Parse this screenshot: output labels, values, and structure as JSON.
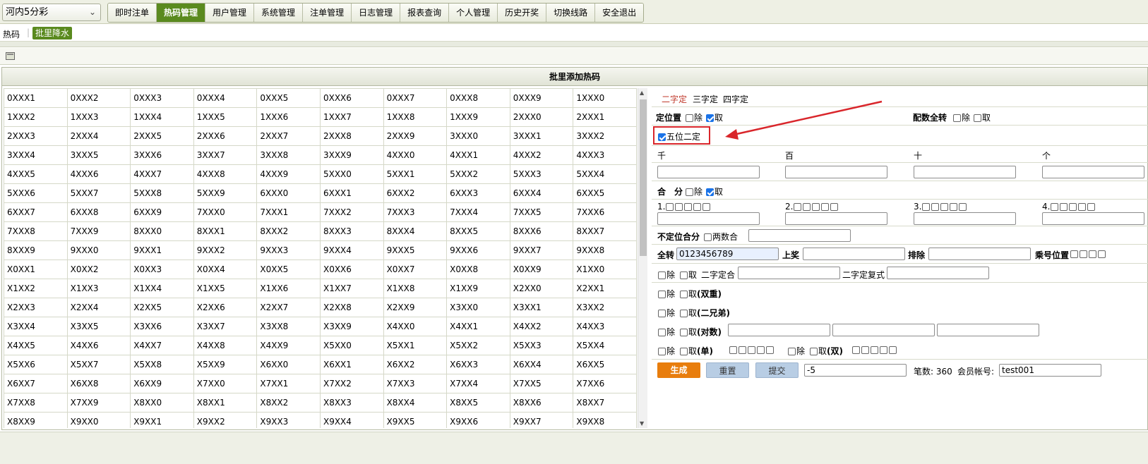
{
  "lottery_select": {
    "value": "河内5分彩"
  },
  "nav": {
    "tabs": [
      "即时注单",
      "热码管理",
      "用户管理",
      "系统管理",
      "注单管理",
      "日志管理",
      "报表查询",
      "个人管理",
      "历史开奖",
      "切换线路",
      "安全退出"
    ],
    "active_index": 1
  },
  "subbar": {
    "label": "热码",
    "action": "批里降水"
  },
  "panel": {
    "title": "批里添加热码"
  },
  "grid": {
    "rows": [
      [
        "0XXX1",
        "0XXX2",
        "0XXX3",
        "0XXX4",
        "0XXX5",
        "0XXX6",
        "0XXX7",
        "0XXX8",
        "0XXX9",
        "1XXX0"
      ],
      [
        "1XXX2",
        "1XXX3",
        "1XXX4",
        "1XXX5",
        "1XXX6",
        "1XXX7",
        "1XXX8",
        "1XXX9",
        "2XXX0",
        "2XXX1"
      ],
      [
        "2XXX3",
        "2XXX4",
        "2XXX5",
        "2XXX6",
        "2XXX7",
        "2XXX8",
        "2XXX9",
        "3XXX0",
        "3XXX1",
        "3XXX2"
      ],
      [
        "3XXX4",
        "3XXX5",
        "3XXX6",
        "3XXX7",
        "3XXX8",
        "3XXX9",
        "4XXX0",
        "4XXX1",
        "4XXX2",
        "4XXX3"
      ],
      [
        "4XXX5",
        "4XXX6",
        "4XXX7",
        "4XXX8",
        "4XXX9",
        "5XXX0",
        "5XXX1",
        "5XXX2",
        "5XXX3",
        "5XXX4"
      ],
      [
        "5XXX6",
        "5XXX7",
        "5XXX8",
        "5XXX9",
        "6XXX0",
        "6XXX1",
        "6XXX2",
        "6XXX3",
        "6XXX4",
        "6XXX5"
      ],
      [
        "6XXX7",
        "6XXX8",
        "6XXX9",
        "7XXX0",
        "7XXX1",
        "7XXX2",
        "7XXX3",
        "7XXX4",
        "7XXX5",
        "7XXX6"
      ],
      [
        "7XXX8",
        "7XXX9",
        "8XXX0",
        "8XXX1",
        "8XXX2",
        "8XXX3",
        "8XXX4",
        "8XXX5",
        "8XXX6",
        "8XXX7"
      ],
      [
        "8XXX9",
        "9XXX0",
        "9XXX1",
        "9XXX2",
        "9XXX3",
        "9XXX4",
        "9XXX5",
        "9XXX6",
        "9XXX7",
        "9XXX8"
      ],
      [
        "X0XX1",
        "X0XX2",
        "X0XX3",
        "X0XX4",
        "X0XX5",
        "X0XX6",
        "X0XX7",
        "X0XX8",
        "X0XX9",
        "X1XX0"
      ],
      [
        "X1XX2",
        "X1XX3",
        "X1XX4",
        "X1XX5",
        "X1XX6",
        "X1XX7",
        "X1XX8",
        "X1XX9",
        "X2XX0",
        "X2XX1"
      ],
      [
        "X2XX3",
        "X2XX4",
        "X2XX5",
        "X2XX6",
        "X2XX7",
        "X2XX8",
        "X2XX9",
        "X3XX0",
        "X3XX1",
        "X3XX2"
      ],
      [
        "X3XX4",
        "X3XX5",
        "X3XX6",
        "X3XX7",
        "X3XX8",
        "X3XX9",
        "X4XX0",
        "X4XX1",
        "X4XX2",
        "X4XX3"
      ],
      [
        "X4XX5",
        "X4XX6",
        "X4XX7",
        "X4XX8",
        "X4XX9",
        "X5XX0",
        "X5XX1",
        "X5XX2",
        "X5XX3",
        "X5XX4"
      ],
      [
        "X5XX6",
        "X5XX7",
        "X5XX8",
        "X5XX9",
        "X6XX0",
        "X6XX1",
        "X6XX2",
        "X6XX3",
        "X6XX4",
        "X6XX5"
      ],
      [
        "X6XX7",
        "X6XX8",
        "X6XX9",
        "X7XX0",
        "X7XX1",
        "X7XX2",
        "X7XX3",
        "X7XX4",
        "X7XX5",
        "X7XX6"
      ],
      [
        "X7XX8",
        "X7XX9",
        "X8XX0",
        "X8XX1",
        "X8XX2",
        "X8XX3",
        "X8XX4",
        "X8XX5",
        "X8XX6",
        "X8XX7"
      ],
      [
        "X8XX9",
        "X9XX0",
        "X9XX1",
        "X9XX2",
        "X9XX3",
        "X9XX4",
        "X9XX5",
        "X9XX6",
        "X9XX7",
        "X9XX8"
      ]
    ]
  },
  "modes": {
    "tabs": [
      "二字定",
      "三字定",
      "四字定"
    ],
    "active_index": 0
  },
  "options": {
    "dingweizhi": "定位置",
    "chu": "除",
    "qu": "取",
    "peishu": "配数全转",
    "wuwei": "五位二定",
    "positions": [
      "千",
      "百",
      "十",
      "个"
    ],
    "hefen": "合　分",
    "hefen_labels": [
      "1.",
      "2.",
      "3.",
      "4."
    ],
    "budingwei": "不定位合分",
    "liangshuhe": "两数合",
    "quanzhuan": "全转",
    "quanzhuan_value": "0123456789",
    "shangjiang": "上奖",
    "paichu": "排除",
    "chenghao": "乘号位置",
    "erzidinghe": "二字定合",
    "erzidingfushi": "二字定复式",
    "shuangchong": "(双重)",
    "erxiongdi": "(二兄弟)",
    "duishu": "(对数)",
    "dan": "(单)",
    "shuang": "(双)"
  },
  "actions": {
    "generate": "生成",
    "reset": "重置",
    "submit": "提交",
    "amount_value": "-5",
    "count_label": "笔数: 360",
    "member_label": "会员帐号:",
    "member_value": "test001"
  },
  "colors": {
    "nav_active": "#5a8a1e",
    "generate": "#e87d0d",
    "annotation_arrow": "#d9262b",
    "mode_active": "#c0392b"
  }
}
